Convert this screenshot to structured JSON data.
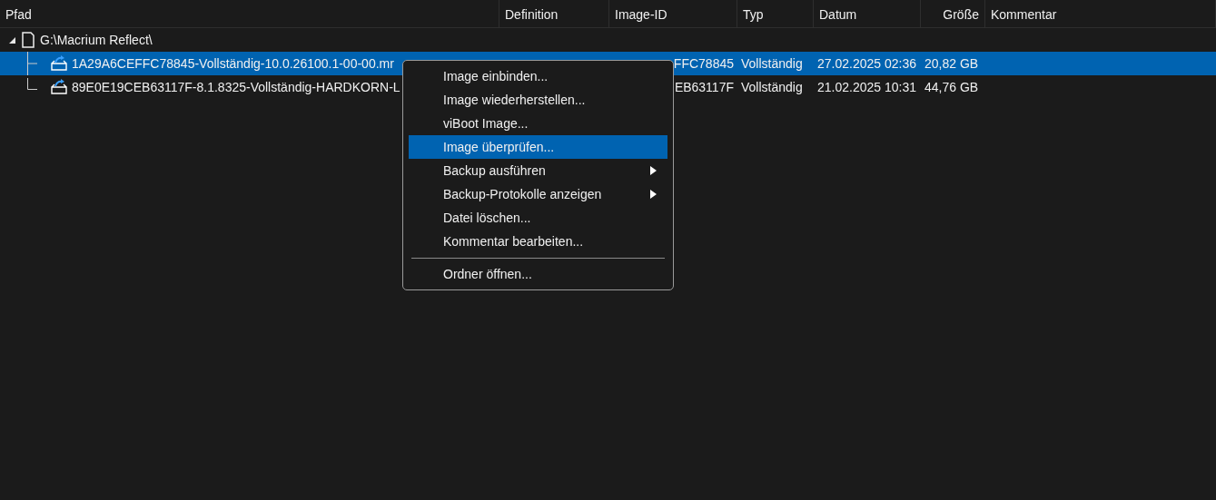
{
  "columns": [
    "Pfad",
    "Definition",
    "Image-ID",
    "Typ",
    "Datum",
    "Größe",
    "Kommentar"
  ],
  "tree": {
    "label": "G:\\Macrium Reflect\\",
    "expanded": true,
    "children": [
      {
        "name": "1A29A6CEFFC78845-Vollständig-10.0.26100.1-00-00.mr",
        "image_id": "FFC78845",
        "type": "Vollständig",
        "date": "27.02.2025 02:36",
        "size": "20,82 GB",
        "selected": true
      },
      {
        "name": "89E0E19CEB63117F-8.1.8325-Vollständig-HARDKORN-L",
        "image_id": "EB63117F",
        "type": "Vollständig",
        "date": "21.02.2025 10:31",
        "size": "44,76 GB",
        "selected": false
      }
    ]
  },
  "context_menu": [
    {
      "label": "Image einbinden...",
      "selected": false,
      "submenu": false
    },
    {
      "label": "Image wiederherstellen...",
      "selected": false,
      "submenu": false
    },
    {
      "label": "viBoot Image...",
      "selected": false,
      "submenu": false
    },
    {
      "label": "Image überprüfen...",
      "selected": true,
      "submenu": false
    },
    {
      "label": "Backup ausführen",
      "selected": false,
      "submenu": true
    },
    {
      "label": "Backup-Protokolle anzeigen",
      "selected": false,
      "submenu": true
    },
    {
      "label": "Datei löschen...",
      "selected": false,
      "submenu": false
    },
    {
      "label": "Kommentar bearbeiten...",
      "selected": false,
      "submenu": false
    },
    {
      "kind": "separator"
    },
    {
      "label": "Ordner öffnen...",
      "selected": false,
      "submenu": false
    }
  ]
}
